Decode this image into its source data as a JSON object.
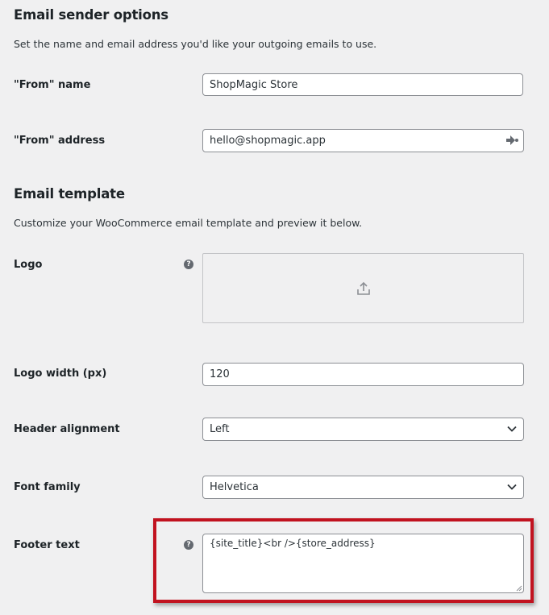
{
  "sender": {
    "title": "Email sender options",
    "description": "Set the name and email address you'd like your outgoing emails to use.",
    "from_name_label": "\"From\" name",
    "from_name_value": "ShopMagic Store",
    "from_address_label": "\"From\" address",
    "from_address_value": "hello@shopmagic.app",
    "autofill_icon": "autofill-icon"
  },
  "template": {
    "title": "Email template",
    "description": "Customize your WooCommerce email template and preview it below.",
    "logo_label": "Logo",
    "logo_help_icon": "?",
    "upload_icon": "upload-icon",
    "logo_width_label": "Logo width (px)",
    "logo_width_value": "120",
    "header_alignment_label": "Header alignment",
    "header_alignment_value": "Left",
    "font_family_label": "Font family",
    "font_family_value": "Helvetica",
    "footer_text_label": "Footer text",
    "footer_help_icon": "?",
    "footer_text_value": "{site_title}<br />{store_address}"
  },
  "colors": {
    "highlight": "#c1121f",
    "background": "#f0f0f1",
    "input_border": "#8c8f94"
  }
}
